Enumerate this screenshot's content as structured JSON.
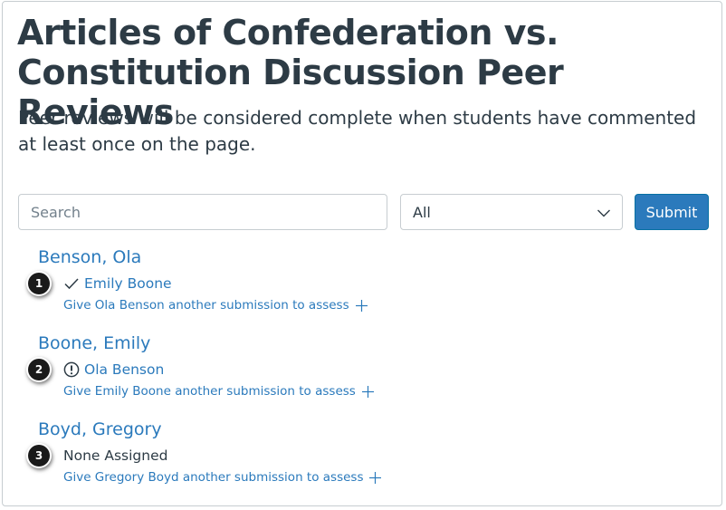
{
  "page": {
    "title": "Articles of Confederation vs. Constitution Discussion Peer Reviews",
    "description": "Peer reviews will be considered complete when students have commented at least once on the page."
  },
  "filters": {
    "search_placeholder": "Search",
    "search_value": "",
    "select_value": "All",
    "submit_label": "Submit"
  },
  "students": [
    {
      "name": "Benson, Ola",
      "assessment": "Emily Boone",
      "status": "complete",
      "status_icon": "checkmark-icon",
      "give_label": "Give Ola Benson another submission to assess",
      "callout": "1"
    },
    {
      "name": "Boone, Emily",
      "assessment": "Ola Benson",
      "status": "incomplete",
      "status_icon": "warning-icon",
      "give_label": "Give Emily Boone another submission to assess",
      "callout": "2"
    },
    {
      "name": "Boyd, Gregory",
      "assessment": "None Assigned",
      "status": "none",
      "status_icon": "",
      "give_label": "Give Gregory Boyd another submission to assess",
      "callout": "3"
    }
  ],
  "colors": {
    "link": "#2b7abc",
    "text": "#2d3b45",
    "button": "#2b7abc",
    "border": "#c7cdd1",
    "callout": "#1a1a1a"
  }
}
